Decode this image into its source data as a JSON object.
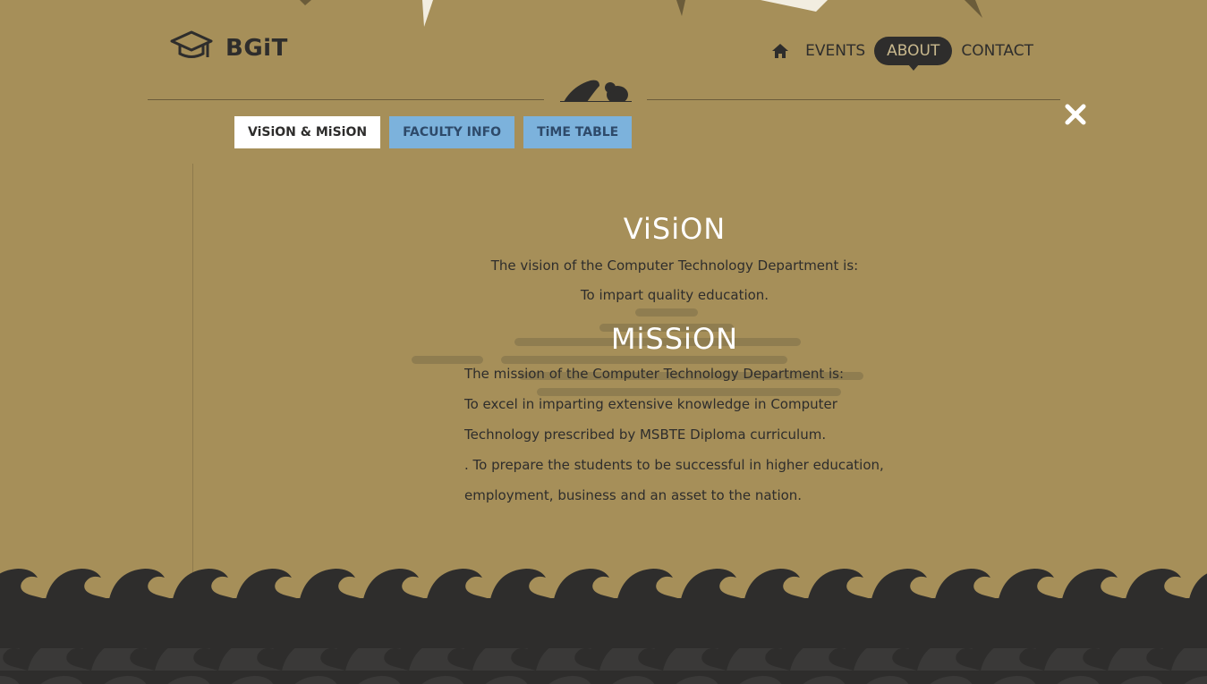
{
  "header": {
    "logo_text": "BGiT",
    "nav": {
      "events_label": "EVENTS",
      "about_label": "ABOUT",
      "contact_label": "CONTACT"
    }
  },
  "tabs": [
    {
      "label": "ViSiON & MiSiON",
      "active": true
    },
    {
      "label": "FACULTY INFO",
      "active": false
    },
    {
      "label": "TiME TABLE",
      "active": false
    }
  ],
  "vision": {
    "heading": "ViSiON",
    "lines": [
      "The vision of the Computer Technology Department is:",
      "To impart quality education."
    ]
  },
  "mission": {
    "heading": "MiSSiON",
    "lines": [
      "The mission of the Computer Technology Department is:",
      "To excel in imparting extensive knowledge in Computer",
      "Technology prescribed by MSBTE Diploma curriculum.",
      ". To prepare the students to be successful in higher education,",
      "employment, business and an asset to the nation."
    ]
  },
  "colors": {
    "background": "#a68f59",
    "dark": "#2e2d2c",
    "tab_active": "#ffffff",
    "tab_inactive": "#7cb2dc"
  },
  "icons": {
    "logo": "graduation-cap-icon",
    "home": "home-icon",
    "close": "close-icon"
  }
}
